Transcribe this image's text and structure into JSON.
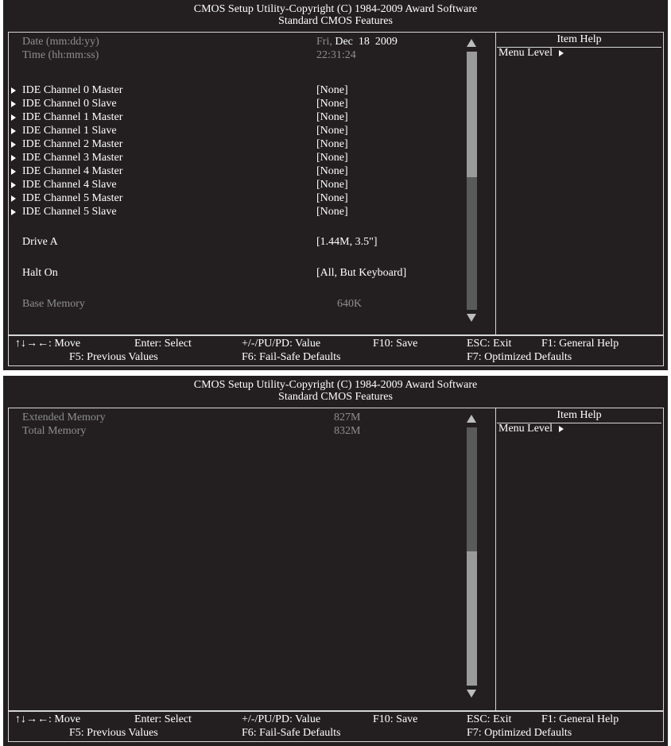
{
  "title": {
    "line1": "CMOS Setup Utility-Copyright (C) 1984-2009 Award Software",
    "line2": "Standard CMOS Features"
  },
  "page1": {
    "rows": [
      {
        "label": "Date (mm:dd:yy)",
        "value_prefix": "Fri,",
        "value_main": "Dec  18  2009"
      },
      {
        "label": "Time (hh:mm:ss)",
        "value": "22:31:24"
      },
      {
        "label": "IDE Channel 0 Master",
        "value": "[None]"
      },
      {
        "label": "IDE Channel 0 Slave",
        "value": "[None]"
      },
      {
        "label": "IDE Channel 1 Master",
        "value": "[None]"
      },
      {
        "label": "IDE Channel 1 Slave",
        "value": "[None]"
      },
      {
        "label": "IDE Channel 2 Master",
        "value": "[None]"
      },
      {
        "label": "IDE Channel 3 Master",
        "value": "[None]"
      },
      {
        "label": "IDE Channel 4 Master",
        "value": "[None]"
      },
      {
        "label": "IDE Channel 4 Slave",
        "value": "[None]"
      },
      {
        "label": "IDE Channel 5 Master",
        "value": "[None]"
      },
      {
        "label": "IDE Channel 5 Slave",
        "value": "[None]"
      },
      {
        "label": "Drive A",
        "value": "[1.44M, 3.5\"]"
      },
      {
        "label": "Halt On",
        "value": "[All, But Keyboard]"
      },
      {
        "label": "Base Memory",
        "value": "640K"
      }
    ]
  },
  "page2": {
    "rows": [
      {
        "label": "Extended Memory",
        "value": "827M"
      },
      {
        "label": "Total Memory",
        "value": "832M"
      }
    ]
  },
  "help": {
    "title": "Item Help",
    "menu_level": "Menu Level"
  },
  "footer": {
    "move": "↑↓→←: Move",
    "enter": "Enter: Select",
    "value": "+/-/PU/PD: Value",
    "save": "F10: Save",
    "esc": "ESC: Exit",
    "f1": "F1: General Help",
    "f5": "F5: Previous Values",
    "f6": "F6: Fail-Safe Defaults",
    "f7": "F7: Optimized Defaults"
  },
  "colors": {
    "background": "#231f20",
    "text": "#ffffff",
    "dim_text": "#8e8e8e",
    "border": "#d6d6d6"
  }
}
